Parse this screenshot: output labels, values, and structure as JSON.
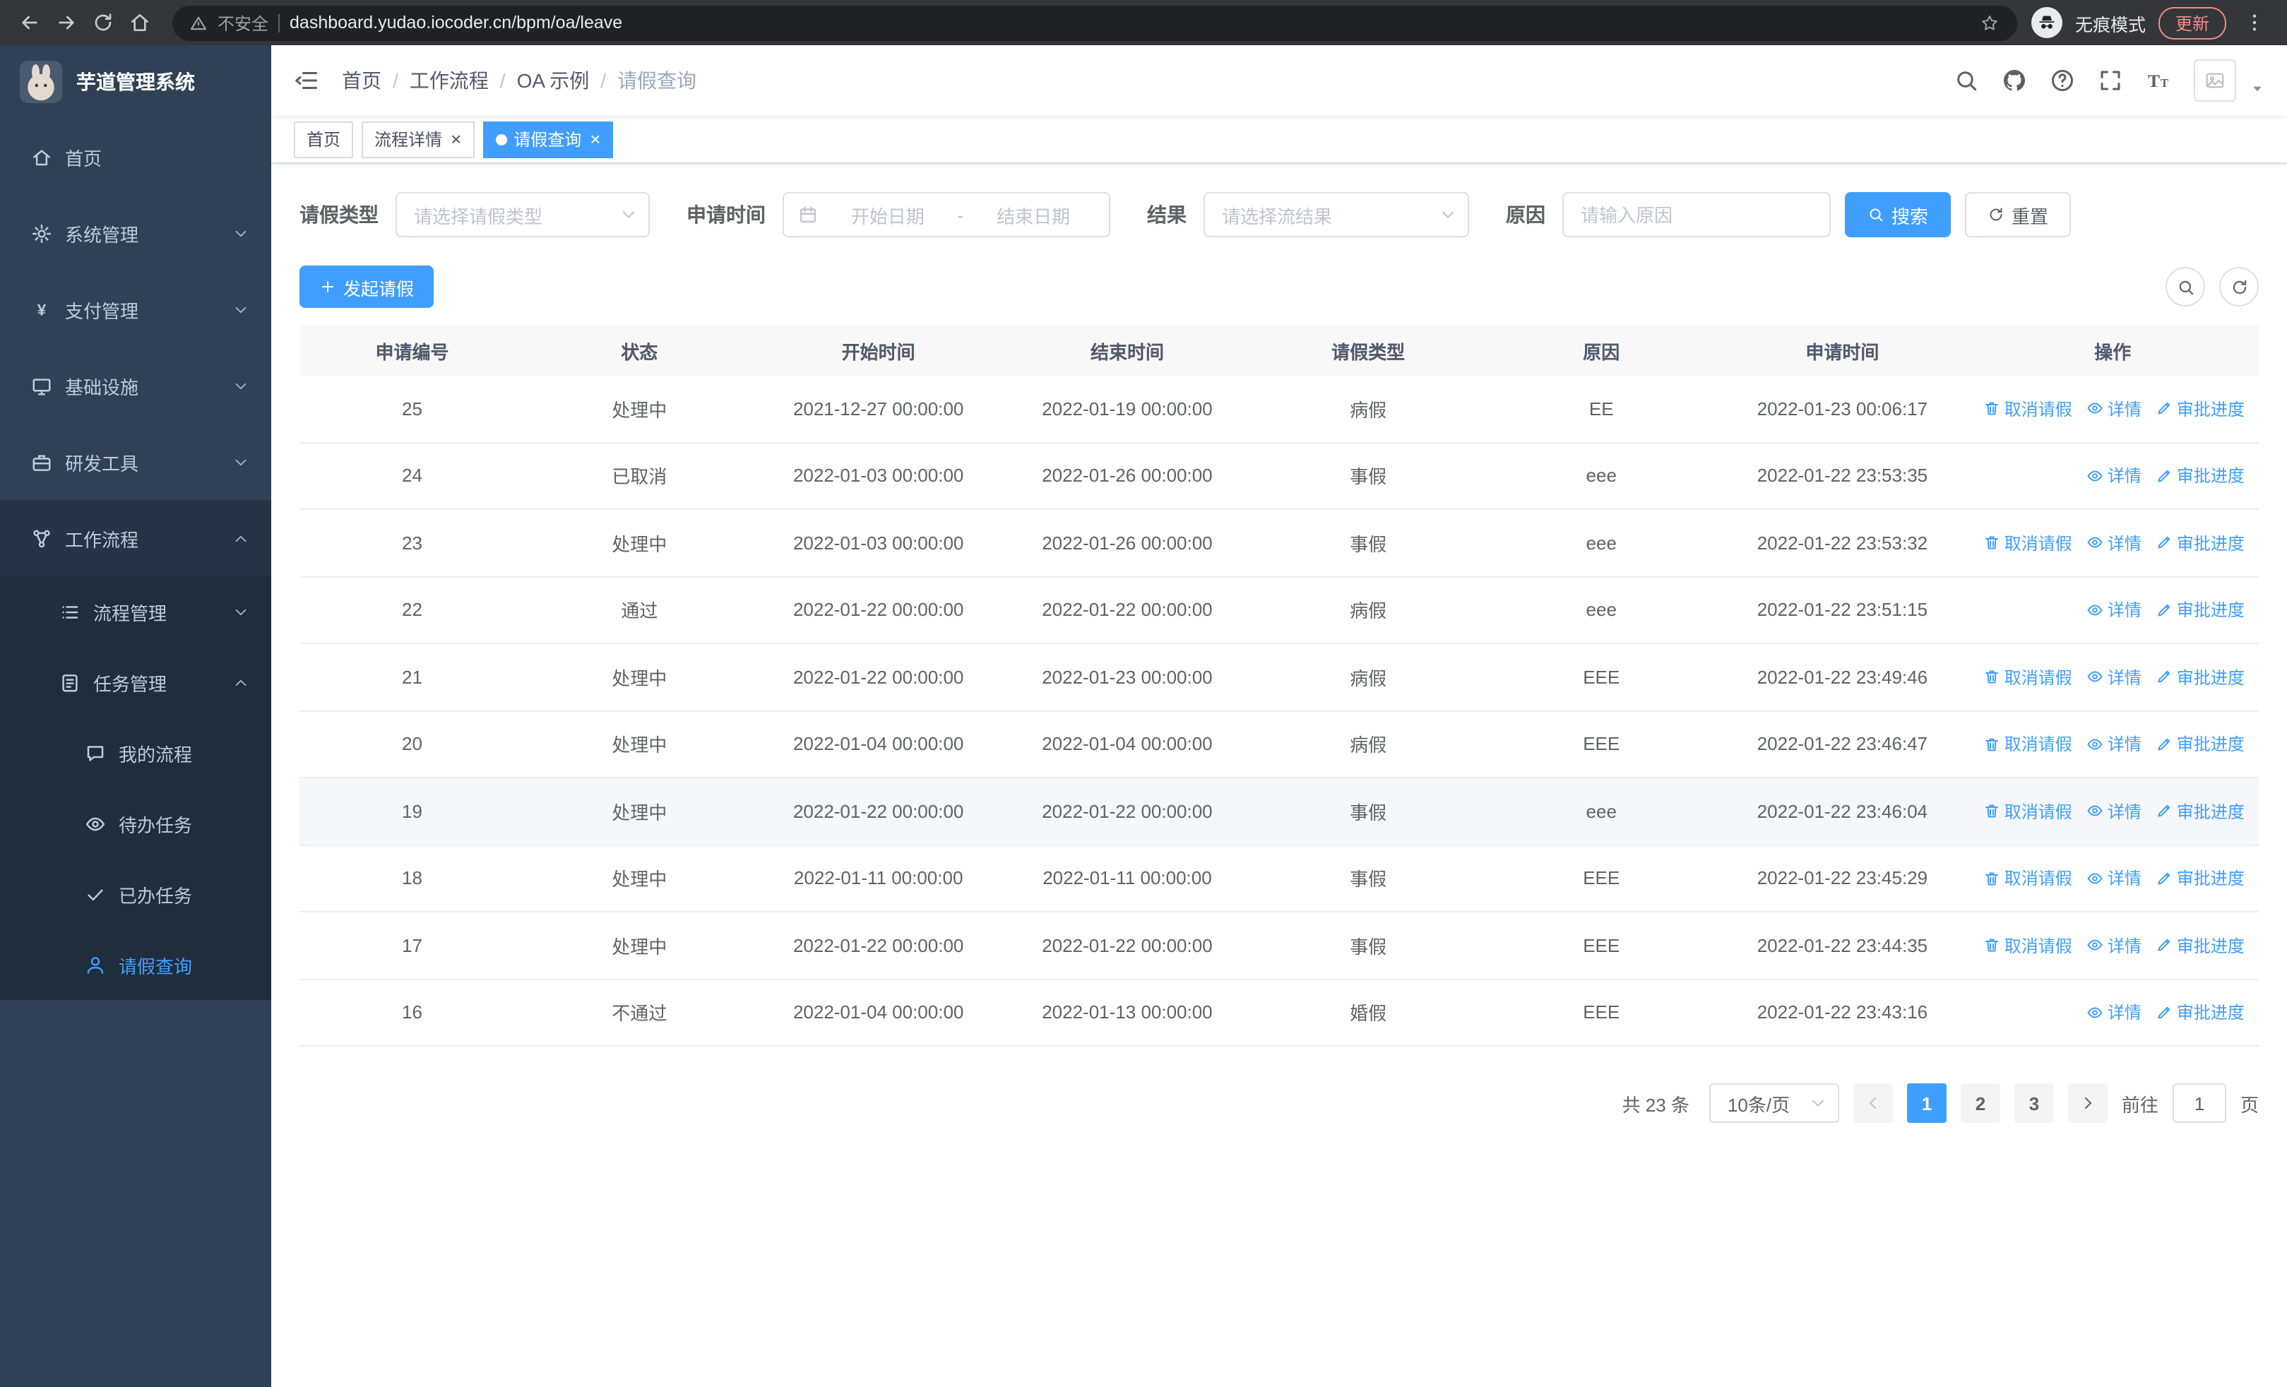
{
  "browser": {
    "security_label": "不安全",
    "url": "dashboard.yudao.iocoder.cn/bpm/oa/leave",
    "incognito_label": "无痕模式",
    "update_label": "更新"
  },
  "sidebar": {
    "logo_title": "芋道管理系统",
    "items": [
      {
        "label": "首页",
        "icon": "home-icon",
        "level": 1
      },
      {
        "label": "系统管理",
        "icon": "gear-icon",
        "level": 1,
        "arrow": "down"
      },
      {
        "label": "支付管理",
        "icon": "yen-icon",
        "level": 1,
        "arrow": "down"
      },
      {
        "label": "基础设施",
        "icon": "monitor-icon",
        "level": 1,
        "arrow": "down"
      },
      {
        "label": "研发工具",
        "icon": "briefcase-icon",
        "level": 1,
        "arrow": "down"
      },
      {
        "label": "工作流程",
        "icon": "workflow-icon",
        "level": 1,
        "arrow": "up",
        "open": true
      },
      {
        "label": "流程管理",
        "icon": "list-icon",
        "level": 2,
        "arrow": "down",
        "sub": true
      },
      {
        "label": "任务管理",
        "icon": "task-icon",
        "level": 2,
        "arrow": "up",
        "sub": true
      },
      {
        "label": "我的流程",
        "icon": "chat-icon",
        "level": 3,
        "sub": true
      },
      {
        "label": "待办任务",
        "icon": "eye-icon",
        "level": 3,
        "sub": true
      },
      {
        "label": "已办任务",
        "icon": "check-icon",
        "level": 3,
        "sub": true
      },
      {
        "label": "请假查询",
        "icon": "user-icon",
        "level": 3,
        "sub": true,
        "active": true
      }
    ]
  },
  "header": {
    "breadcrumb": [
      "首页",
      "工作流程",
      "OA 示例",
      "请假查询"
    ]
  },
  "tabs": [
    {
      "label": "首页",
      "closable": false,
      "active": false
    },
    {
      "label": "流程详情",
      "closable": true,
      "active": false
    },
    {
      "label": "请假查询",
      "closable": true,
      "active": true
    }
  ],
  "filters": {
    "leave_type": {
      "label": "请假类型",
      "placeholder": "请选择请假类型"
    },
    "apply_time": {
      "label": "申请时间",
      "start_placeholder": "开始日期",
      "separator": "-",
      "end_placeholder": "结束日期"
    },
    "result": {
      "label": "结果",
      "placeholder": "请选择流结果"
    },
    "reason": {
      "label": "原因",
      "placeholder": "请输入原因"
    },
    "search_label": "搜索",
    "reset_label": "重置"
  },
  "toolbar": {
    "create_label": "发起请假"
  },
  "table": {
    "columns": [
      "申请编号",
      "状态",
      "开始时间",
      "结束时间",
      "请假类型",
      "原因",
      "申请时间",
      "操作"
    ],
    "action_labels": {
      "cancel": "取消请假",
      "detail": "详情",
      "progress": "审批进度"
    },
    "rows": [
      {
        "id": "25",
        "status": "处理中",
        "start": "2021-12-27 00:00:00",
        "end": "2022-01-19 00:00:00",
        "type": "病假",
        "reason": "EE",
        "applied": "2022-01-23 00:06:17",
        "actions": [
          "cancel",
          "detail",
          "progress"
        ]
      },
      {
        "id": "24",
        "status": "已取消",
        "start": "2022-01-03 00:00:00",
        "end": "2022-01-26 00:00:00",
        "type": "事假",
        "reason": "eee",
        "applied": "2022-01-22 23:53:35",
        "actions": [
          "detail",
          "progress"
        ]
      },
      {
        "id": "23",
        "status": "处理中",
        "start": "2022-01-03 00:00:00",
        "end": "2022-01-26 00:00:00",
        "type": "事假",
        "reason": "eee",
        "applied": "2022-01-22 23:53:32",
        "actions": [
          "cancel",
          "detail",
          "progress"
        ]
      },
      {
        "id": "22",
        "status": "通过",
        "start": "2022-01-22 00:00:00",
        "end": "2022-01-22 00:00:00",
        "type": "病假",
        "reason": "eee",
        "applied": "2022-01-22 23:51:15",
        "actions": [
          "detail",
          "progress"
        ]
      },
      {
        "id": "21",
        "status": "处理中",
        "start": "2022-01-22 00:00:00",
        "end": "2022-01-23 00:00:00",
        "type": "病假",
        "reason": "EEE",
        "applied": "2022-01-22 23:49:46",
        "actions": [
          "cancel",
          "detail",
          "progress"
        ]
      },
      {
        "id": "20",
        "status": "处理中",
        "start": "2022-01-04 00:00:00",
        "end": "2022-01-04 00:00:00",
        "type": "病假",
        "reason": "EEE",
        "applied": "2022-01-22 23:46:47",
        "actions": [
          "cancel",
          "detail",
          "progress"
        ]
      },
      {
        "id": "19",
        "status": "处理中",
        "start": "2022-01-22 00:00:00",
        "end": "2022-01-22 00:00:00",
        "type": "事假",
        "reason": "eee",
        "applied": "2022-01-22 23:46:04",
        "actions": [
          "cancel",
          "detail",
          "progress"
        ],
        "highlight": true
      },
      {
        "id": "18",
        "status": "处理中",
        "start": "2022-01-11 00:00:00",
        "end": "2022-01-11 00:00:00",
        "type": "事假",
        "reason": "EEE",
        "applied": "2022-01-22 23:45:29",
        "actions": [
          "cancel",
          "detail",
          "progress"
        ]
      },
      {
        "id": "17",
        "status": "处理中",
        "start": "2022-01-22 00:00:00",
        "end": "2022-01-22 00:00:00",
        "type": "事假",
        "reason": "EEE",
        "applied": "2022-01-22 23:44:35",
        "actions": [
          "cancel",
          "detail",
          "progress"
        ]
      },
      {
        "id": "16",
        "status": "不通过",
        "start": "2022-01-04 00:00:00",
        "end": "2022-01-13 00:00:00",
        "type": "婚假",
        "reason": "EEE",
        "applied": "2022-01-22 23:43:16",
        "actions": [
          "detail",
          "progress"
        ]
      }
    ]
  },
  "pagination": {
    "total_label": "共 23 条",
    "page_size": "10条/页",
    "pages": [
      "1",
      "2",
      "3"
    ],
    "active_page": "1",
    "goto_label": "前往",
    "goto_value": "1",
    "goto_suffix": "页"
  },
  "colors": {
    "accent": "#409EFF",
    "sidebar_bg": "#304156",
    "submenu_bg": "#1f2d3d",
    "update_red": "#f28b82"
  }
}
